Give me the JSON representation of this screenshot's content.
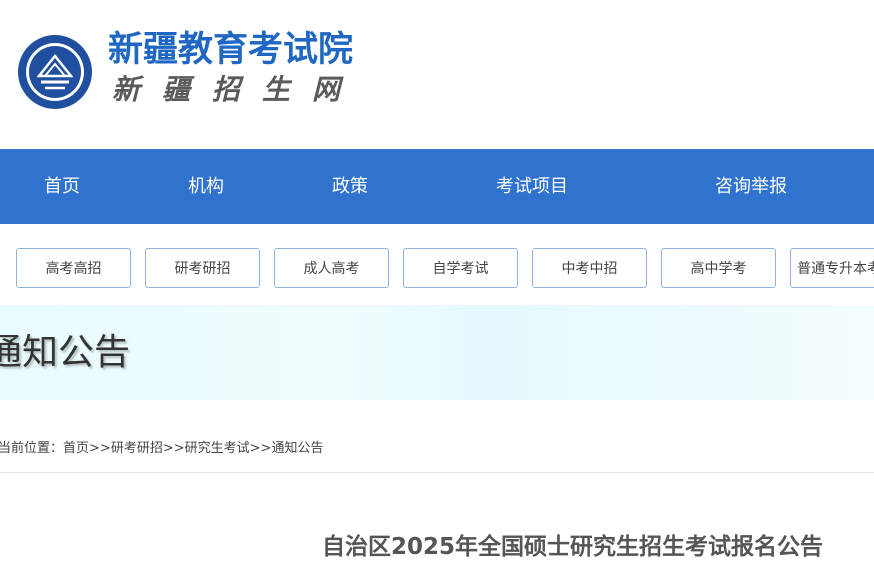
{
  "header": {
    "logo_icon": "seal-logo-icon",
    "seal_text": "新疆教育考试",
    "site_title": "新疆教育考试院",
    "site_subtitle": "新疆招生网"
  },
  "nav": {
    "items": [
      {
        "label": "首页"
      },
      {
        "label": "机构"
      },
      {
        "label": "政策"
      },
      {
        "label": "考试项目"
      },
      {
        "label": "咨询举报"
      }
    ]
  },
  "categories": [
    {
      "label": "高考高招"
    },
    {
      "label": "研考研招"
    },
    {
      "label": "成人高考"
    },
    {
      "label": "自学考试"
    },
    {
      "label": "中考中招"
    },
    {
      "label": "高中学考"
    },
    {
      "label": "普通专升本考"
    }
  ],
  "banner": {
    "title": "通知公告"
  },
  "breadcrumb": {
    "prefix": "当前位置：",
    "items": [
      "首页",
      "研考研招",
      "研究生考试",
      "通知公告"
    ],
    "separator": ">>"
  },
  "article": {
    "title": "自治区2025年全国硕士研究生招生考试报名公告"
  },
  "colors": {
    "brand_blue": "#1f67c2",
    "nav_blue": "#2f73cf",
    "button_border": "#8fb2e0"
  }
}
